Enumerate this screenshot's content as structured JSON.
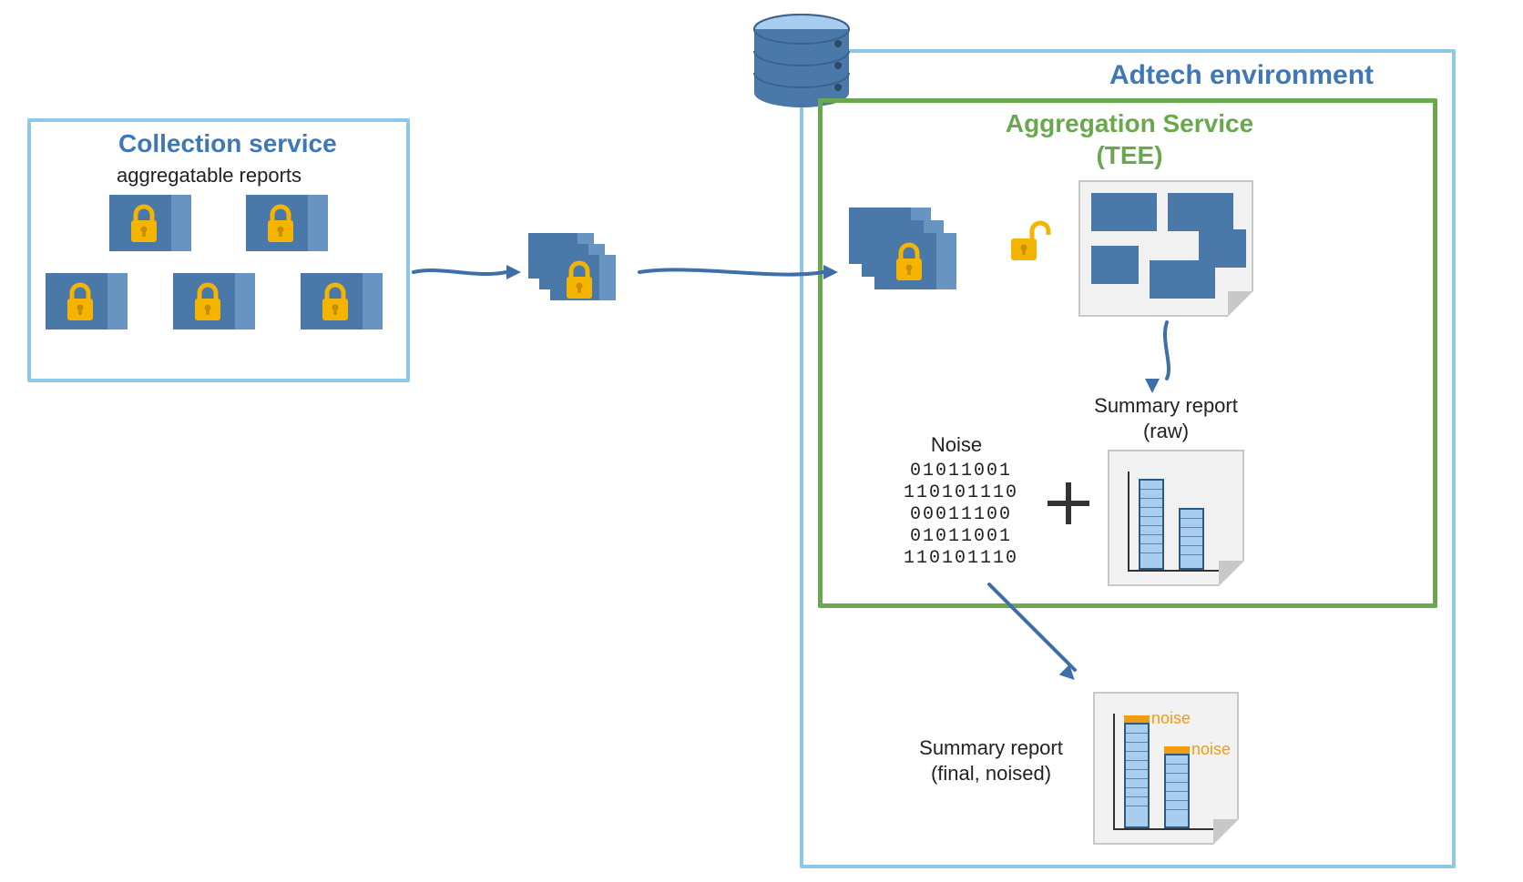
{
  "collection": {
    "title": "Collection service",
    "subtitle": "aggregatable reports"
  },
  "adtech": {
    "title": "Adtech environment"
  },
  "aggregation": {
    "title": "Aggregation Service\n(TEE)"
  },
  "noise": {
    "title": "Noise",
    "lines": [
      "01011001",
      "110101110",
      "00011100",
      "01011001",
      "110101110"
    ]
  },
  "summary_raw": {
    "title": "Summary report\n(raw)"
  },
  "summary_final": {
    "title": "Summary report\n(final, noised)",
    "noise_label": "noise"
  },
  "icons": {
    "lock": "lock-icon",
    "unlock": "unlock-icon",
    "database": "database-icon"
  },
  "colors": {
    "boxBlue": "#8fc9ea",
    "boxGreen": "#6aa84f",
    "titleBlue": "#3f78b5",
    "cardBlue": "#4a78a8",
    "cardBlueLight": "#6894c2",
    "lockYellow": "#f5b400",
    "noiseOrange": "#f39c12",
    "barFill": "#a8cdee"
  }
}
